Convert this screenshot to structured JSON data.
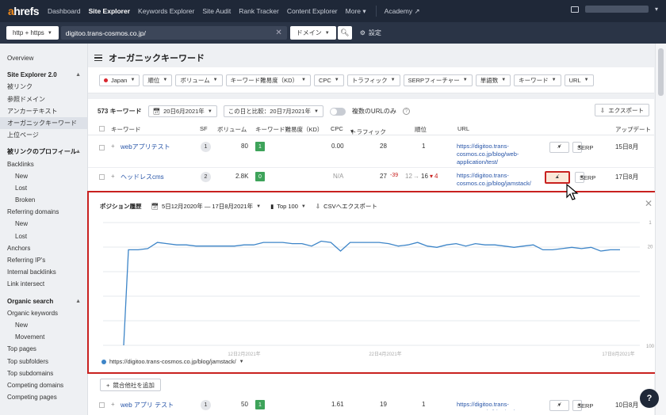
{
  "nav": {
    "logo_a": "a",
    "logo_rest": "hrefs",
    "items": [
      "Dashboard",
      "Site Explorer",
      "Keywords Explorer",
      "Site Audit",
      "Rank Tracker",
      "Content Explorer",
      "More"
    ],
    "academy": "Academy"
  },
  "search": {
    "protocol": "http + https",
    "url": "digitoo.trans-cosmos.co.jp/",
    "mode": "ドメイン",
    "settings": "設定"
  },
  "sidebar": {
    "overview": "Overview",
    "se_head": "Site Explorer 2.0",
    "se_items": [
      "被リンク",
      "参照ドメイン",
      "アンカーテキスト",
      "オーガニックキーワード",
      "上位ページ"
    ],
    "profile_head": "被リンクのプロフィール",
    "backlinks": "Backlinks",
    "backlinks_sub": [
      "New",
      "Lost",
      "Broken"
    ],
    "refdomains": "Referring domains",
    "refdomains_sub": [
      "New",
      "Lost"
    ],
    "others": [
      "Anchors",
      "Referring IP's",
      "Internal backlinks",
      "Link intersect"
    ],
    "organic_head": "Organic search",
    "organic_kw": "Organic keywords",
    "organic_sub": [
      "New",
      "Movement"
    ],
    "organic_others": [
      "Top pages",
      "Top subfolders",
      "Top subdomains",
      "Competing domains",
      "Competing pages"
    ]
  },
  "page": {
    "title": "オーガニックキーワード"
  },
  "filters": [
    "Japan",
    "順位",
    "ボリューム",
    "キーワード難易度（KD）",
    "CPC",
    "トラフィック",
    "SERPフィーチャー",
    "単語数",
    "キーワード",
    "URL"
  ],
  "results": {
    "count": "573 キーワード",
    "date": "20日6月2021年",
    "compare": "この日と比較：20日7月2021年",
    "multi_url": "複数のURLのみ",
    "export": "エクスポート",
    "columns": {
      "keyword": "キーワード",
      "sf": "SF",
      "volume": "ボリューム",
      "kd": "キーワード難易度（KD）",
      "cpc": "CPC",
      "traffic": "トラフィック",
      "position": "順位",
      "url": "URL",
      "update": "アップデート"
    },
    "rows": [
      {
        "keyword": "webアプリテスト",
        "sf": "1",
        "volume": "80",
        "kd": "1",
        "cpc": "0.00",
        "traffic": "28",
        "position": "1",
        "url": "https://digitoo.trans-cosmos.co.jp/blog/web-application/test/",
        "serp": "SERP",
        "update": "15日8月"
      },
      {
        "keyword": "ヘッドレスcms",
        "sf": "2",
        "volume": "2.8K",
        "kd": "0",
        "cpc": "N/A",
        "traffic": "27",
        "traffic_delta": "-39",
        "position_from": "12",
        "position_to": "16",
        "position_delta": "4",
        "url": "https://digitoo.trans-cosmos.co.jp/blog/jamstack/",
        "serp": "SERP",
        "update": "17日8月"
      },
      {
        "keyword": "web アプリ テスト",
        "sf": "1",
        "volume": "50",
        "kd": "1",
        "cpc": "1.61",
        "traffic": "19",
        "position": "1",
        "url": "https://digitoo.trans-cosmos.co.jp/blog/web-application/test",
        "serp": "SERP",
        "update": "10日8月"
      }
    ],
    "add_competitor": "競合他社を追加"
  },
  "popup": {
    "title": "ポジション履歴",
    "range": "5日12月2020年 — 17日8月2021年",
    "top": "Top 100",
    "csv": "CSVへエクスポート",
    "legend": "https://digitoo.trans-cosmos.co.jp/blog/jamstack/",
    "chart_data": {
      "type": "line",
      "x_tick_labels": [
        "12日2月2021年",
        "22日4月2021年",
        "17日8月2021年"
      ],
      "y_tick_labels": [
        "1",
        "20",
        "100"
      ],
      "ylim": [
        1,
        100
      ],
      "y_inverted": true,
      "series": [
        {
          "values": [
            100,
            23,
            23,
            22,
            17,
            18,
            19,
            19,
            20,
            20,
            20,
            20,
            20,
            19,
            19,
            17,
            17,
            17,
            18,
            18,
            20,
            16,
            17,
            24,
            17,
            17,
            17,
            17,
            18,
            20,
            19,
            17,
            20,
            21,
            19,
            18,
            20,
            18,
            19,
            19,
            20,
            21,
            20,
            19,
            23,
            23,
            22,
            21,
            22,
            21,
            24,
            23,
            23
          ]
        }
      ]
    }
  },
  "colors": {
    "accent_red": "#c8211f",
    "nav_bg": "#1f2838",
    "line": "#3d85c8",
    "kd_green": "#3ea35a"
  }
}
